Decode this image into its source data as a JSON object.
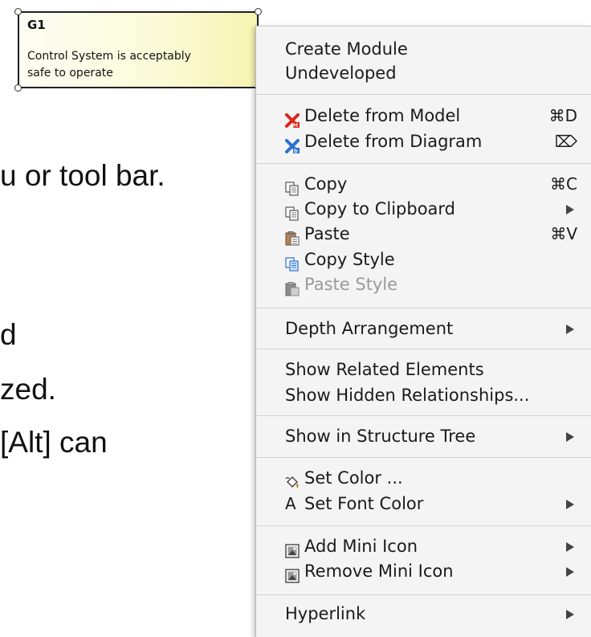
{
  "node": {
    "id": "G1",
    "text_line1": "Control System is acceptably",
    "text_line2": "safe to operate"
  },
  "background_text": {
    "line1": "u or tool bar.",
    "line2": "d",
    "line3": "zed.",
    "line4": "[Alt] can"
  },
  "menu": {
    "create_module": "Create Module",
    "undeveloped": "Undeveloped",
    "delete_from_model": "Delete from Model",
    "delete_from_model_shortcut": "⌘D",
    "delete_from_diagram": "Delete from Diagram",
    "delete_from_diagram_shortcut": "⌦",
    "copy": "Copy",
    "copy_shortcut": "⌘C",
    "copy_to_clipboard": "Copy to Clipboard",
    "paste": "Paste",
    "paste_shortcut": "⌘V",
    "copy_style": "Copy Style",
    "paste_style": "Paste Style",
    "depth_arrangement": "Depth Arrangement",
    "show_related_elements": "Show Related Elements",
    "show_hidden_relationships": "Show Hidden Relationships...",
    "show_in_structure_tree": "Show in Structure Tree",
    "set_color": "Set Color ...",
    "set_font_color": "Set Font Color",
    "set_font_color_icon_glyph": "A",
    "add_mini_icon": "Add Mini Icon",
    "remove_mini_icon": "Remove Mini Icon",
    "hyperlink": "Hyperlink"
  },
  "icons": {
    "delete_from_model": "delete-model-icon",
    "delete_from_diagram": "delete-diagram-icon",
    "copy": "copy-icon",
    "copy_to_clipboard": "copy-icon",
    "paste": "paste-icon",
    "copy_style": "copy-style-icon",
    "paste_style": "paste-style-icon",
    "set_color": "paint-bucket-icon",
    "mini_icon": "mini-icon-icon"
  },
  "colors": {
    "menu_background": "#f4f4f4",
    "disabled_text": "#9a9a9a",
    "delete_red": "#d9261c",
    "delete_blue": "#2a6fd0",
    "node_fill": "#fbfbd8"
  }
}
